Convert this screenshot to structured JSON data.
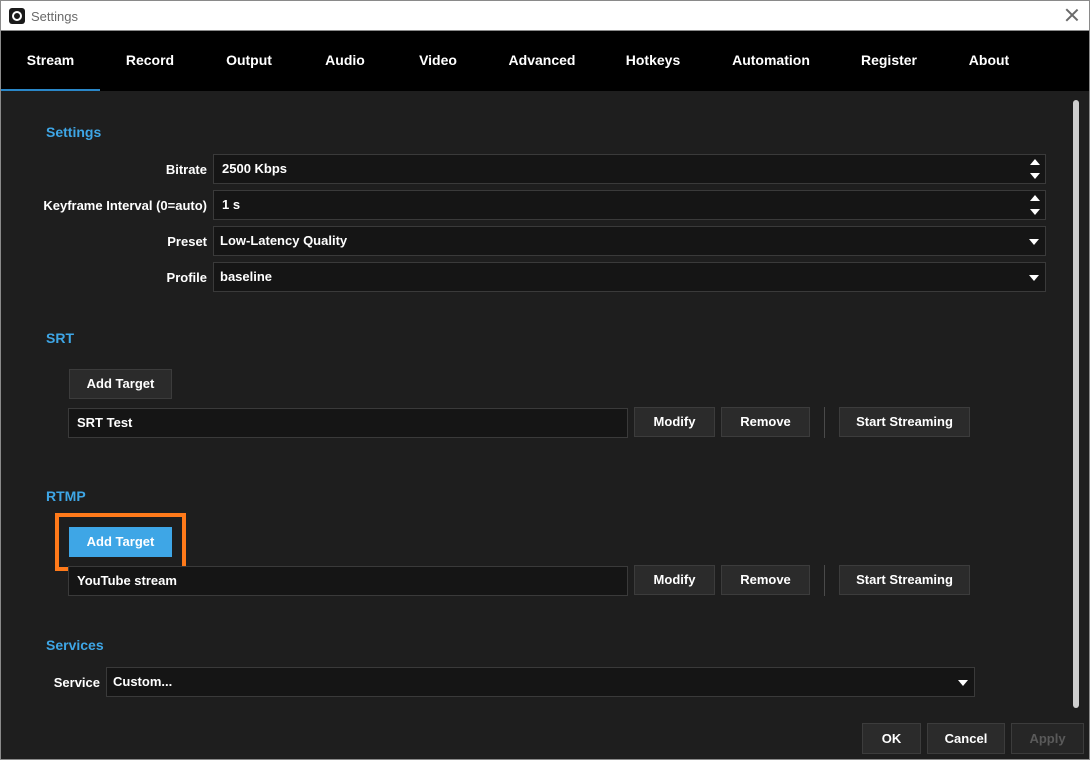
{
  "window": {
    "title": "Settings"
  },
  "tabs": [
    "Stream",
    "Record",
    "Output",
    "Audio",
    "Video",
    "Advanced",
    "Hotkeys",
    "Automation",
    "Register",
    "About"
  ],
  "settings": {
    "title": "Settings",
    "bitrate_label": "Bitrate",
    "bitrate_value": "2500 Kbps",
    "keyframe_label": "Keyframe Interval (0=auto)",
    "keyframe_value": "1 s",
    "preset_label": "Preset",
    "preset_value": "Low-Latency Quality",
    "profile_label": "Profile",
    "profile_value": "baseline"
  },
  "srt": {
    "title": "SRT",
    "add_target_label": "Add Target",
    "target_name": "SRT Test",
    "modify_label": "Modify",
    "remove_label": "Remove",
    "start_label": "Start Streaming"
  },
  "rtmp": {
    "title": "RTMP",
    "add_target_label": "Add Target",
    "target_name": "YouTube stream",
    "modify_label": "Modify",
    "remove_label": "Remove",
    "start_label": "Start Streaming"
  },
  "services": {
    "title": "Services",
    "service_label": "Service",
    "service_value": "Custom..."
  },
  "footer": {
    "ok_label": "OK",
    "cancel_label": "Cancel",
    "apply_label": "Apply"
  },
  "colors": {
    "accent": "#3ea6e6",
    "highlight": "#ff7a1a",
    "tab_underline": "#2a87c8"
  }
}
